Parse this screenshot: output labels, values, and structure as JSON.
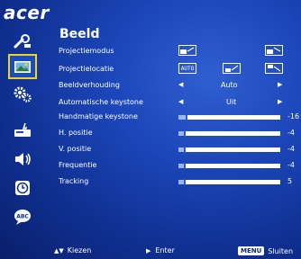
{
  "brand": {
    "logo_text": "acer"
  },
  "menu": {
    "title": "Beeld"
  },
  "sidebar": {
    "items": [
      {
        "icon": "wrench-icon"
      },
      {
        "icon": "picture-icon",
        "active": true
      },
      {
        "icon": "gears-icon"
      },
      {
        "icon": "projector-settings-icon"
      },
      {
        "icon": "speaker-icon"
      },
      {
        "icon": "clock-icon"
      },
      {
        "icon": "language-icon"
      }
    ]
  },
  "rows": {
    "projectiemodus": {
      "label": "Projectiemodus"
    },
    "projectielocatie": {
      "label": "Projectielocatie",
      "auto_label": "AUTO"
    },
    "beeldverhouding": {
      "label": "Beeldverhouding",
      "value": "Auto"
    },
    "auto_keystone": {
      "label": "Automatische keystone",
      "value": "Uit"
    },
    "handmatige_keystone": {
      "label": "Handmatige keystone",
      "value": "-16",
      "level": 0.08
    },
    "h_positie": {
      "label": "H. positie",
      "value": "-4",
      "level": 0.06
    },
    "v_positie": {
      "label": "V. positie",
      "value": "-4",
      "level": 0.06
    },
    "frequentie": {
      "label": "Frequentie",
      "value": "-4",
      "level": 0.06
    },
    "tracking": {
      "label": "Tracking",
      "value": "5",
      "level": 0.06
    }
  },
  "footer": {
    "select_label": "Kiezen",
    "enter_label": "Enter",
    "menu_key": "MENU",
    "close_label": "Sluiten"
  },
  "colors": {
    "accent": "#f2d21a",
    "background": "#1b45b8",
    "bar": "#ffffff"
  }
}
